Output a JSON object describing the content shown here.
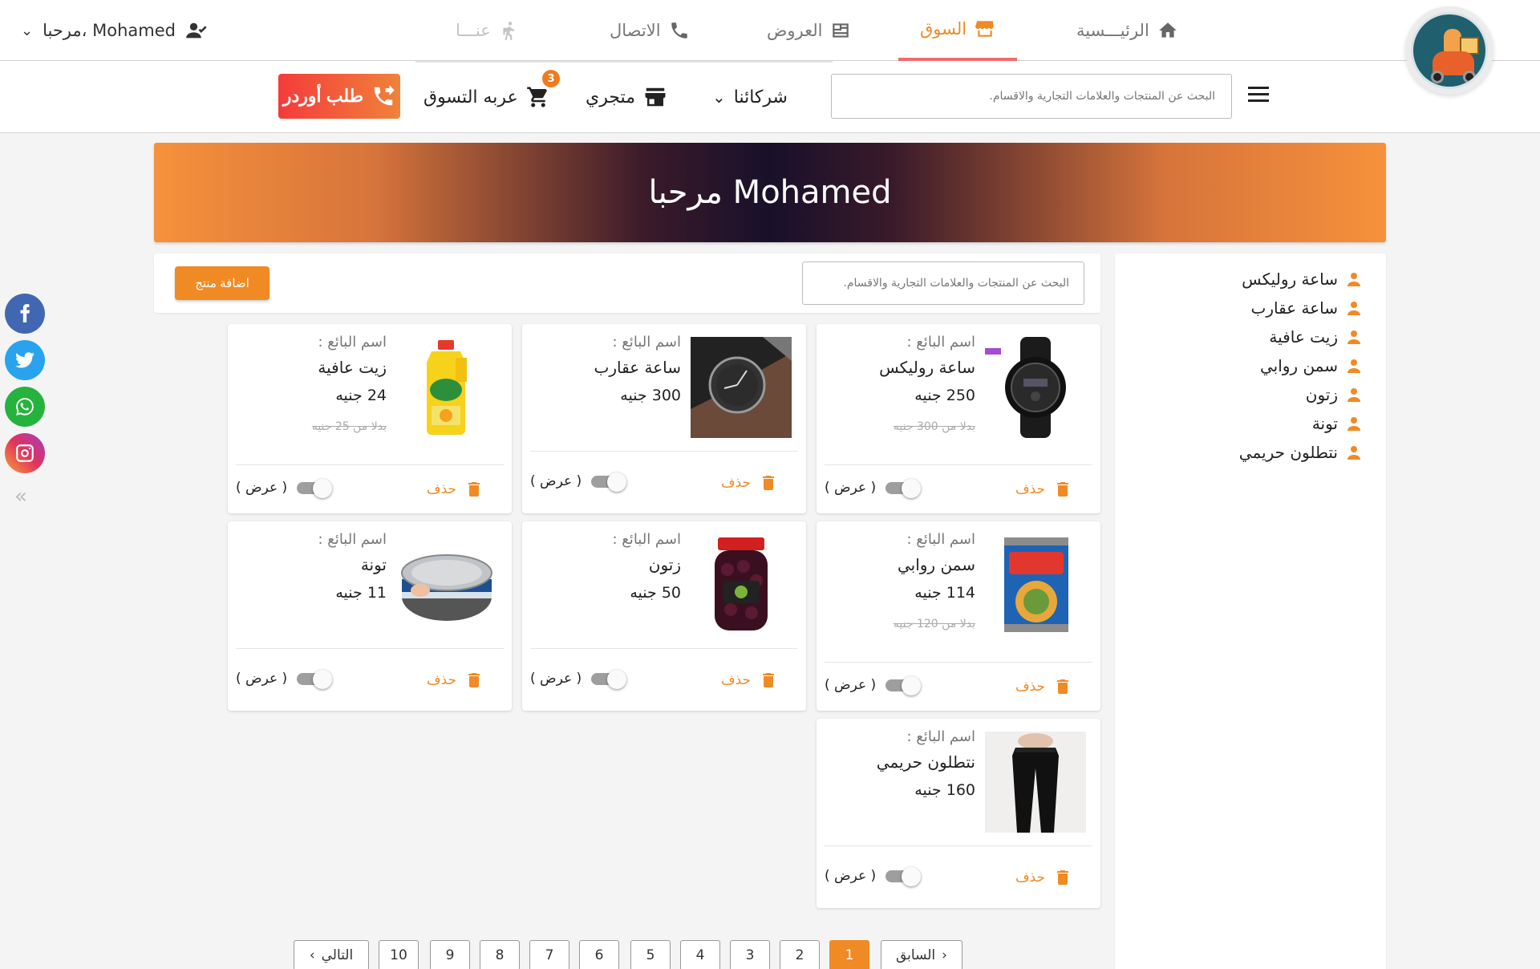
{
  "nav": {
    "home": "الرئيـــسية",
    "market": "السوق",
    "offers": "العروض",
    "contact": "الاتصال",
    "about": "عنـــا",
    "user_greeting": "مرحبا، Mohamed"
  },
  "subbar": {
    "search_placeholder": "البحث عن المنتجات والعلامات التجارية والاقسام.",
    "partners": "شركائنا",
    "my_store": "متجري",
    "cart": "عربه التسوق",
    "cart_count": "3",
    "order_button": "طلب أوردر"
  },
  "banner": {
    "title": "مرحبا Mohamed"
  },
  "toolbar": {
    "search_placeholder": "البحث عن المنتجات والعلامات التجارية والاقسام.",
    "add_product": "اضافة منتج"
  },
  "sidebar": {
    "items": [
      "ساعة روليكس",
      "ساعة عقارب",
      "زيت عافية",
      "سمن روابي",
      "زتون",
      "تونة",
      "نتطلون حريمي"
    ]
  },
  "products": [
    {
      "seller_label": "اسم البائع :",
      "name": "ساعة روليكس",
      "price": "250 جنيه",
      "old_price": "بدلا من 300 جنيه",
      "delete": "حذف",
      "show": "( عرض )",
      "visible": false,
      "image": "black-digital-watch"
    },
    {
      "seller_label": "اسم البائع :",
      "name": "ساعة عقارب",
      "price": "300 جنيه",
      "old_price": "",
      "delete": "حذف",
      "show": "( عرض )",
      "visible": false,
      "image": "analog-watch-brown-strap"
    },
    {
      "seller_label": "اسم البائع :",
      "name": "زيت عافية",
      "price": "24 جنيه",
      "old_price": "بدلا من 25 جنيه",
      "delete": "حذف",
      "show": "( عرض )",
      "visible": false,
      "image": "oil-bottle"
    },
    {
      "seller_label": "اسم البائع :",
      "name": "سمن روابي",
      "price": "114 جنيه",
      "old_price": "بدلا من 120 جنيه",
      "delete": "حذف",
      "show": "( عرض )",
      "visible": false,
      "image": "ghee-tin"
    },
    {
      "seller_label": "اسم البائع :",
      "name": "زتون",
      "price": "50 جنيه",
      "old_price": "",
      "delete": "حذف",
      "show": "( عرض )",
      "visible": false,
      "image": "olive-jar"
    },
    {
      "seller_label": "اسم البائع :",
      "name": "تونة",
      "price": "11 جنيه",
      "old_price": "",
      "delete": "حذف",
      "show": "( عرض )",
      "visible": false,
      "image": "tuna-can"
    },
    {
      "seller_label": "اسم البائع :",
      "name": "نتطلون حريمي",
      "price": "160 جنيه",
      "old_price": "",
      "delete": "حذف",
      "show": "( عرض )",
      "visible": false,
      "image": "black-pants"
    }
  ],
  "pagination": {
    "prev": "السابق",
    "next": "التالي",
    "pages": [
      "1",
      "2",
      "3",
      "4",
      "5",
      "6",
      "7",
      "8",
      "9",
      "10"
    ],
    "current": "1"
  },
  "colors": {
    "accent": "#f08a24",
    "active_underline": "#f06b6b"
  }
}
